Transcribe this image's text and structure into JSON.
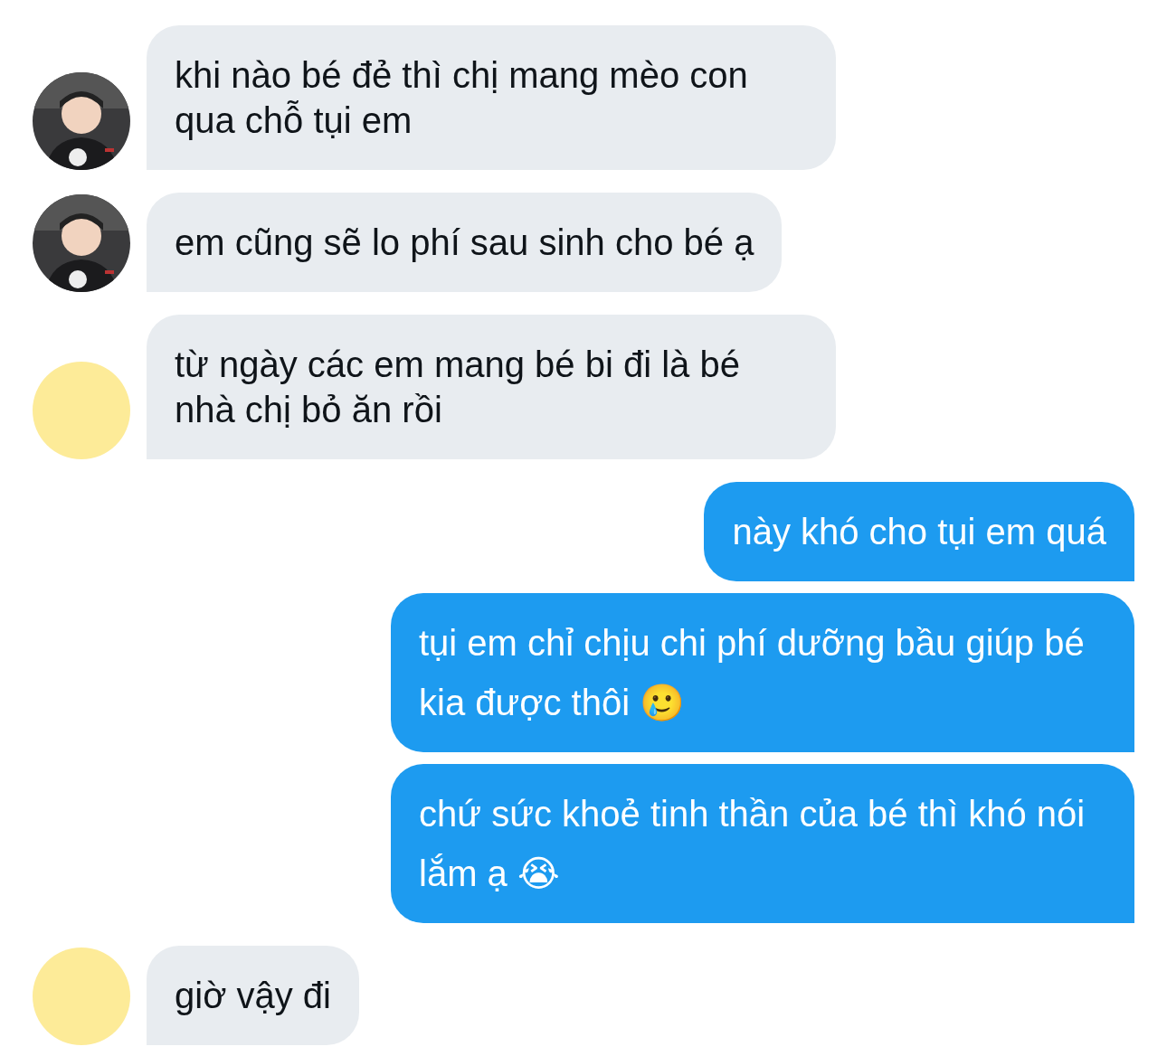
{
  "messages": [
    {
      "kind": "incoming",
      "text": "khi nào bé đẻ thì chị mang mèo con qua chỗ tụi em"
    },
    {
      "kind": "incoming",
      "text": "em cũng sẽ lo phí sau sinh cho bé ạ"
    },
    {
      "kind": "incoming",
      "avatar": {
        "kind": "placeholder",
        "color": "#fdeb98"
      },
      "text": "từ ngày các em mang bé bi đi là bé nhà chị bỏ ăn rồi"
    },
    {
      "kind": "outgoing",
      "text": "này khó cho tụi em quá"
    },
    {
      "kind": "outgoing",
      "text": "tụi em chỉ chịu chi phí dưỡng bầu giúp bé kia được thôi 🥲"
    },
    {
      "kind": "outgoing",
      "text": "chứ sức khoẻ tinh thần của bé thì khó nói lắm ạ 😭"
    },
    {
      "kind": "incoming",
      "avatar": {
        "kind": "placeholder",
        "color": "#fdeb98"
      },
      "text": "giờ vậy đi"
    }
  ]
}
